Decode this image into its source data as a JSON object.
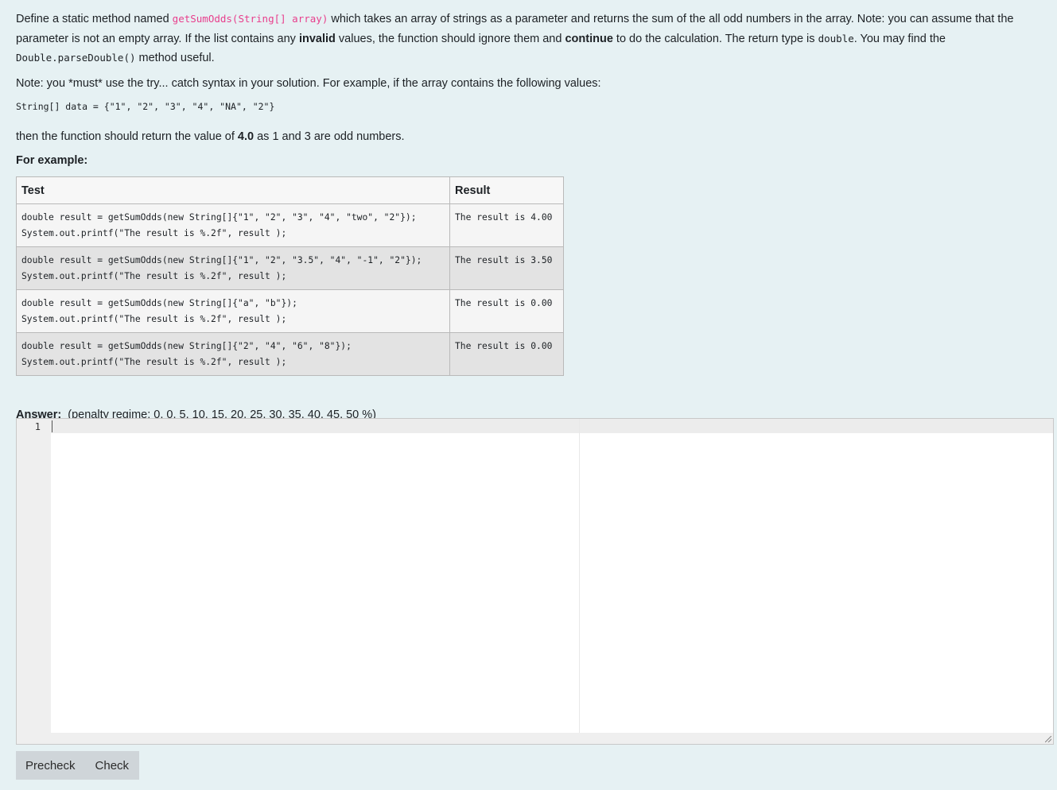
{
  "question": {
    "p1_a": "Define a static method named ",
    "p1_method": "getSumOdds(String[] array)",
    "p1_b": " which takes an array of strings as a parameter and returns the sum of the all odd numbers in the array. Note: you can assume that the parameter is not an empty array. If the list contains any ",
    "p1_invalid": "invalid",
    "p1_c": " values, the function should ignore them and ",
    "p1_continue": "continue",
    "p1_d": " to do the calculation. The return type is ",
    "p1_double": "double",
    "p1_e": ". You may find the ",
    "p1_parse": "Double.parseDouble()",
    "p1_f": " method useful.",
    "p2": "Note: you *must* use the try... catch syntax in your solution. For example, if the array contains the following values:",
    "code_example": "String[] data = {\"1\", \"2\", \"3\", \"4\", \"NA\", \"2\"}",
    "p3_a": "then the function should return the value of ",
    "p3_value": "4.0",
    "p3_b": " as 1 and 3 are odd numbers.",
    "for_example": "For example:"
  },
  "table": {
    "headers": {
      "test": "Test",
      "result": "Result"
    },
    "rows": [
      {
        "test": "double result = getSumOdds(new String[]{\"1\", \"2\", \"3\", \"4\", \"two\", \"2\"});\nSystem.out.printf(\"The result is %.2f\", result );",
        "result": "The result is 4.00"
      },
      {
        "test": "double result = getSumOdds(new String[]{\"1\", \"2\", \"3.5\", \"4\", \"-1\", \"2\"});\nSystem.out.printf(\"The result is %.2f\", result );",
        "result": "The result is 3.50"
      },
      {
        "test": "double result = getSumOdds(new String[]{\"a\", \"b\"});\nSystem.out.printf(\"The result is %.2f\", result );",
        "result": "The result is 0.00"
      },
      {
        "test": "double result = getSumOdds(new String[]{\"2\", \"4\", \"6\", \"8\"});\nSystem.out.printf(\"The result is %.2f\", result );",
        "result": "The result is 0.00"
      }
    ]
  },
  "answer": {
    "label": "Answer:",
    "penalty": "(penalty regime: 0, 0, 5, 10, 15, 20, 25, 30, 35, 40, 45, 50 %)",
    "line_number": "1"
  },
  "buttons": {
    "precheck": "Precheck",
    "check": "Check"
  }
}
